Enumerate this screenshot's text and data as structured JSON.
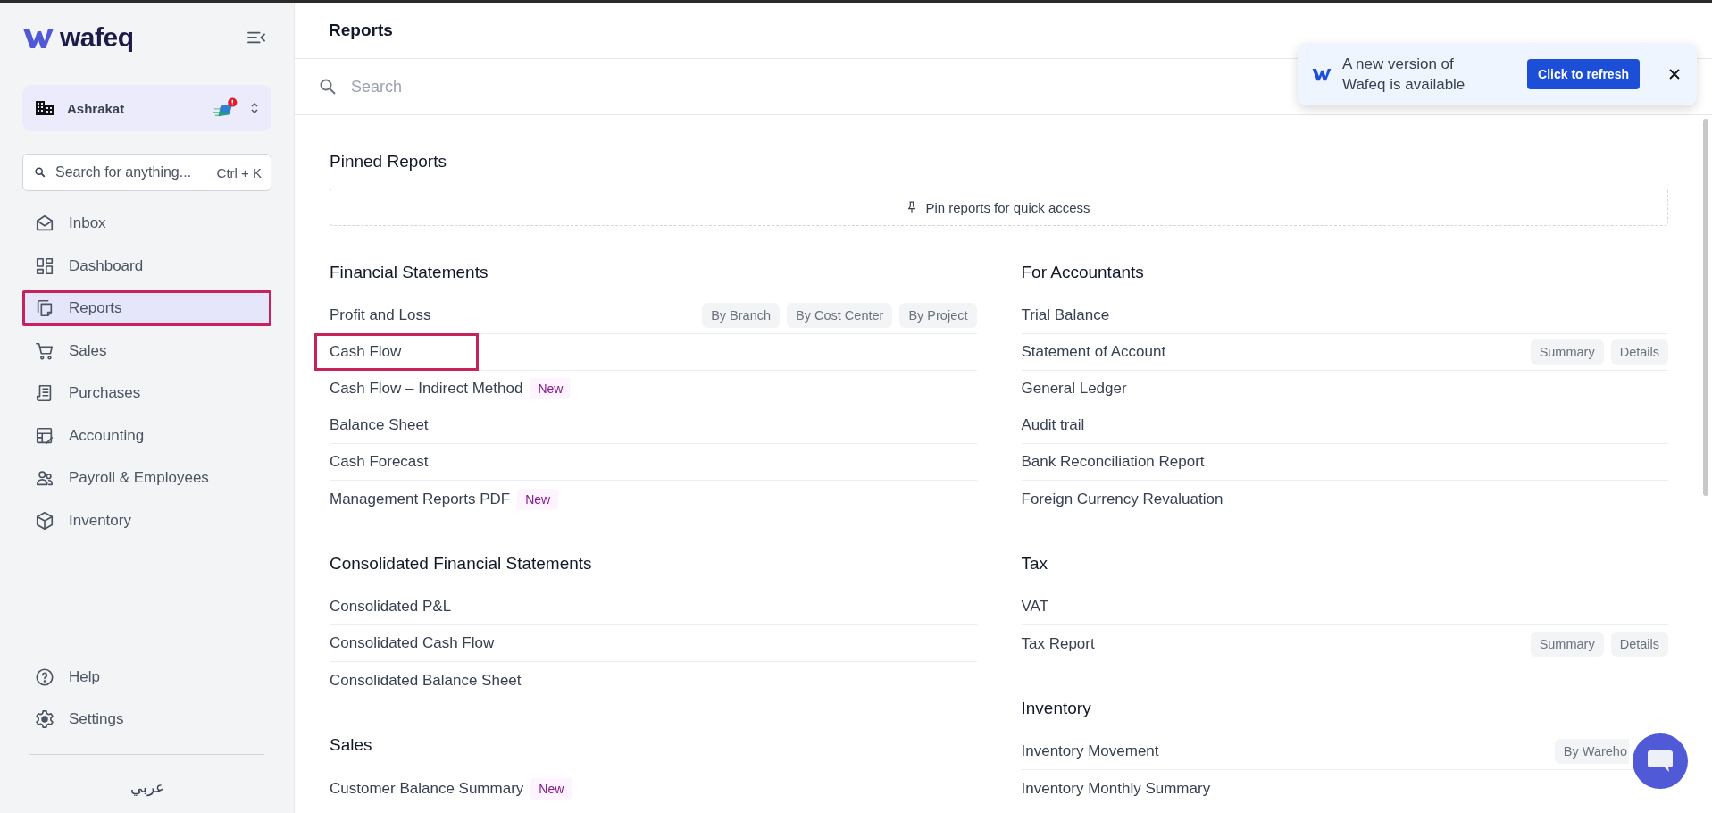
{
  "sidebar": {
    "logo": "wafeq",
    "organization": "Ashrakat",
    "search": {
      "placeholder": "Search for anything...",
      "shortcut": "Ctrl + K"
    },
    "nav": [
      {
        "label": "Inbox",
        "kind": "inbox",
        "selected": false,
        "highlighted": false
      },
      {
        "label": "Dashboard",
        "kind": "dashboard",
        "selected": false,
        "highlighted": false
      },
      {
        "label": "Reports",
        "kind": "reports",
        "selected": true,
        "highlighted": true
      },
      {
        "label": "Sales",
        "kind": "sales",
        "selected": false,
        "highlighted": false
      },
      {
        "label": "Purchases",
        "kind": "purchases",
        "selected": false,
        "highlighted": false
      },
      {
        "label": "Accounting",
        "kind": "accounting",
        "selected": false,
        "highlighted": false
      },
      {
        "label": "Payroll & Employees",
        "kind": "payroll",
        "selected": false,
        "highlighted": false
      },
      {
        "label": "Inventory",
        "kind": "inventory",
        "selected": false,
        "highlighted": false
      }
    ],
    "bottom_nav": [
      {
        "label": "Help",
        "kind": "help"
      },
      {
        "label": "Settings",
        "kind": "settings"
      }
    ],
    "language": "عربي"
  },
  "header": {
    "title": "Reports"
  },
  "search": {
    "placeholder": "Search"
  },
  "pinned": {
    "title": "Pinned Reports",
    "empty_message": "Pin reports for quick access"
  },
  "columns": [
    [
      {
        "title": "Financial Statements",
        "reports": [
          {
            "name": "Profit and Loss",
            "tags": [
              "By Branch",
              "By Cost Center",
              "By Project"
            ],
            "highlighted": false
          },
          {
            "name": "Cash Flow",
            "highlighted": true
          },
          {
            "name": "Cash Flow – Indirect Method",
            "badge": "New",
            "highlighted": false
          },
          {
            "name": "Balance Sheet",
            "highlighted": false
          },
          {
            "name": "Cash Forecast",
            "highlighted": false
          },
          {
            "name": "Management Reports PDF",
            "badge": "New",
            "highlighted": false
          }
        ]
      },
      {
        "title": "Consolidated Financial Statements",
        "reports": [
          {
            "name": "Consolidated P&L",
            "highlighted": false
          },
          {
            "name": "Consolidated Cash Flow",
            "highlighted": false
          },
          {
            "name": "Consolidated Balance Sheet",
            "highlighted": false
          }
        ]
      },
      {
        "title": "Sales",
        "reports": [
          {
            "name": "Customer Balance Summary",
            "badge": "New",
            "highlighted": false
          }
        ]
      }
    ],
    [
      {
        "title": "For Accountants",
        "reports": [
          {
            "name": "Trial Balance",
            "highlighted": false
          },
          {
            "name": "Statement of Account",
            "tags": [
              "Summary",
              "Details"
            ],
            "highlighted": false
          },
          {
            "name": "General Ledger",
            "highlighted": false
          },
          {
            "name": "Audit trail",
            "highlighted": false
          },
          {
            "name": "Bank Reconciliation Report",
            "highlighted": false
          },
          {
            "name": "Foreign Currency Revaluation",
            "highlighted": false
          }
        ]
      },
      {
        "title": "Tax",
        "reports": [
          {
            "name": "VAT",
            "highlighted": false
          },
          {
            "name": "Tax Report",
            "tags": [
              "Summary",
              "Details"
            ],
            "highlighted": false
          }
        ]
      },
      {
        "title": "Inventory",
        "reports": [
          {
            "name": "Inventory Movement",
            "tags": [
              "By Wareho"
            ],
            "tags_covered": true,
            "highlighted": false
          },
          {
            "name": "Inventory Monthly Summary",
            "highlighted": false
          }
        ]
      }
    ]
  ],
  "toast": {
    "message": "A new version of Wafeq is available",
    "button": "Click to refresh"
  }
}
